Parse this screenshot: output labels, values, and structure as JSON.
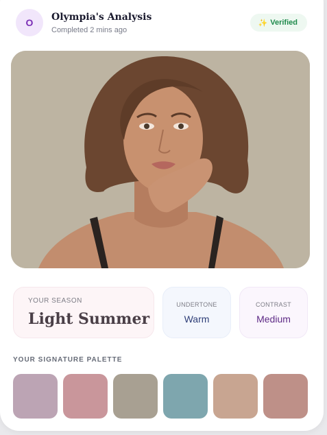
{
  "header": {
    "avatar_initial": "O",
    "title": "Olympia's Analysis",
    "subtitle": "Completed 2 mins ago",
    "badge": {
      "icon": "sparkle-icon",
      "label": "Verified"
    }
  },
  "photo": {
    "description_icon": "portrait-photo"
  },
  "season": {
    "label": "YOUR SEASON",
    "value": "Light Summer"
  },
  "undertone": {
    "label": "UNDERTONE",
    "value": "Warm"
  },
  "contrast": {
    "label": "CONTRAST",
    "value": "Medium"
  },
  "palette": {
    "label": "YOUR SIGNATURE PALETTE",
    "colors": [
      "#bca4b4",
      "#c9969b",
      "#a8a092",
      "#7ea6ae",
      "#c8a591",
      "#be9088"
    ]
  },
  "colors": {
    "accent_purple": "#7b2fb6",
    "verified_green": "#1f8a4c"
  }
}
